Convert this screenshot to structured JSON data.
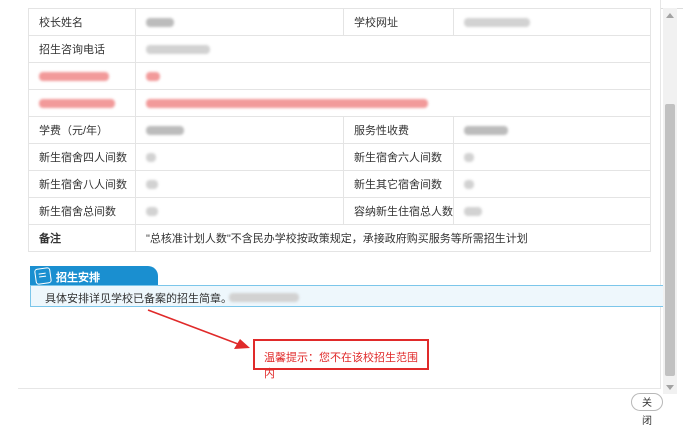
{
  "table": {
    "principal_label": "校长姓名",
    "website_label": "学校网址",
    "phone_label": "招生咨询电话",
    "tuition_label": "学费（元/年）",
    "service_fee_label": "服务性收费",
    "dorm4_label": "新生宿舍四人间数",
    "dorm6_label": "新生宿舍六人间数",
    "dorm8_label": "新生宿舍八人间数",
    "dorm_other_label": "新生其它宿舍间数",
    "dorm_total_label": "新生宿舍总间数",
    "dorm_capacity_label": "容纳新生住宿总人数",
    "remark_label": "备注",
    "remark_text": "\"总核准计划人数\"不含民办学校按政策规定，承接政府购买服务等所需招生计划"
  },
  "section": {
    "title": "招生安排",
    "body": "具体安排详见学校已备案的招生简章。"
  },
  "tip": {
    "text": "温馨提示：您不在该校招生范围内"
  },
  "footer": {
    "close_label": "关闭"
  },
  "colors": {
    "accent_blue": "#1a8fd0",
    "alert_red": "#e02a2a"
  },
  "icons": {
    "section_icon": "document-edit-icon"
  }
}
